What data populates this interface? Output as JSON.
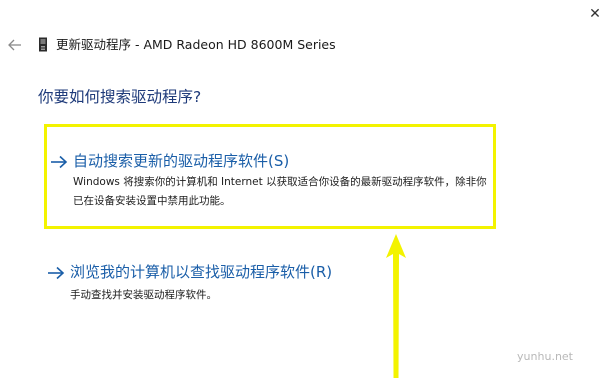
{
  "window": {
    "title": "更新驱动程序 - AMD Radeon HD 8600M Series",
    "close_glyph": "✕"
  },
  "heading": "你要如何搜索驱动程序?",
  "options": [
    {
      "title": "自动搜索更新的驱动程序软件(S)",
      "description": "Windows 将搜索你的计算机和 Internet 以获取适合你设备的最新驱动程序软件，除非你已在设备安装设置中禁用此功能。"
    },
    {
      "title": "浏览我的计算机以查找驱动程序软件(R)",
      "description": "手动查找并安装驱动程序软件。"
    }
  ],
  "watermark": "yunhu.net",
  "colors": {
    "link_blue": "#1a5ea8",
    "heading_blue": "#1e3a7a",
    "highlight_yellow": "#f3f300"
  },
  "icons": {
    "back": "back-arrow-icon",
    "device": "device-icon",
    "option_arrow": "right-arrow-icon",
    "close": "close-icon"
  }
}
